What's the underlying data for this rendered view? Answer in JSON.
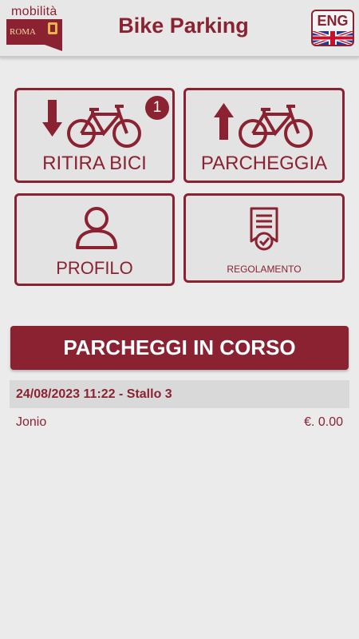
{
  "header": {
    "logo_text": "mobilità",
    "logo_sub": "ROMA",
    "title": "Bike Parking",
    "language_button": "ENG"
  },
  "tiles": {
    "ritira": {
      "label": "RITIRA BICI",
      "badge": "1"
    },
    "parcheggia": {
      "label": "PARCHEGGIA"
    },
    "profilo": {
      "label": "PROFILO"
    },
    "regolamento": {
      "label": "REGOLAMENTO"
    }
  },
  "section": {
    "label": "PARCHEGGI IN CORSO"
  },
  "parking": {
    "title": "24/08/2023 11:22 - Stallo 3",
    "name": "Jonio",
    "amount": "€. 0.00"
  },
  "colors": {
    "brand": "#8b2232",
    "background": "#ebebeb"
  }
}
